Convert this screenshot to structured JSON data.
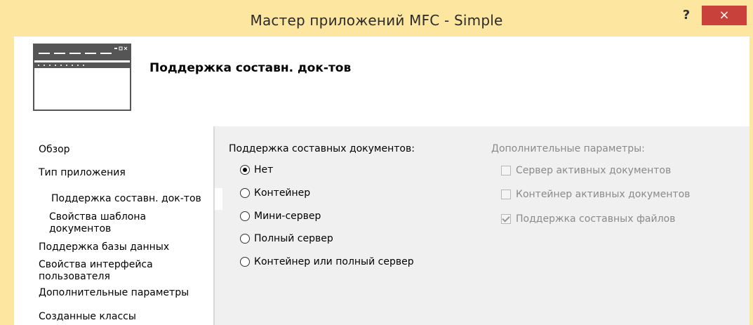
{
  "window": {
    "title": "Мастер приложений MFC - Simple",
    "help_label": "?",
    "close_label": "×"
  },
  "header": {
    "title": "Поддержка составн. док-тов",
    "icon": "wizard-window-icon"
  },
  "nav": {
    "items": [
      {
        "label": "Обзор"
      },
      {
        "label": "Тип приложения"
      },
      {
        "label": "Поддержка составн. док-тов"
      },
      {
        "label": "Свойства шаблона документов"
      },
      {
        "label": "Поддержка базы данных"
      },
      {
        "label": "Свойства интерфейса пользователя"
      },
      {
        "label": "Дополнительные параметры"
      },
      {
        "label": "Созданные классы"
      }
    ]
  },
  "compound": {
    "title": "Поддержка составных документов:",
    "options": [
      {
        "label": "Нет",
        "checked": true
      },
      {
        "label": "Контейнер",
        "checked": false
      },
      {
        "label": "Мини-сервер",
        "checked": false
      },
      {
        "label": "Полный сервер",
        "checked": false
      },
      {
        "label": "Контейнер или полный сервер",
        "checked": false
      }
    ]
  },
  "extra": {
    "title": "Дополнительные параметры:",
    "options": [
      {
        "label": "Сервер активных документов",
        "checked": false
      },
      {
        "label": "Контейнер активных документов",
        "checked": false
      },
      {
        "label": "Поддержка составных файлов",
        "checked": true
      }
    ]
  },
  "colors": {
    "frame": "#fde69f",
    "close_button": "#c8423b",
    "disabled_text": "#8a8a8a"
  }
}
